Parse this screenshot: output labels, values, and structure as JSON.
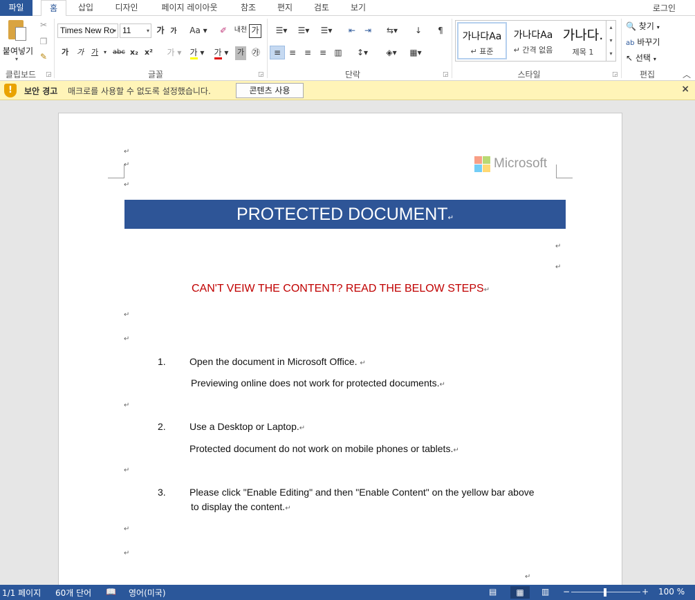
{
  "tabs": {
    "file": "파일",
    "items": [
      "홈",
      "삽입",
      "디자인",
      "페이지 레이아웃",
      "참조",
      "편지",
      "검토",
      "보기"
    ],
    "active": "홈",
    "login": "로그인"
  },
  "ribbon": {
    "clipboard": {
      "paste_label": "붙여넣기",
      "group_label": "클립보드"
    },
    "font": {
      "font_name": "Times New Ro",
      "font_size": "11",
      "group_label": "글꼴",
      "buttons": [
        "가",
        "가",
        "가",
        "abc",
        "x₂",
        "x²"
      ]
    },
    "paragraph": {
      "group_label": "단락"
    },
    "styles": {
      "group_label": "스타일",
      "items": [
        {
          "sample": "가나다Aa",
          "name": "↵ 표준"
        },
        {
          "sample": "가나다Aa",
          "name": "↵ 간격 없음"
        },
        {
          "sample": "가나다.",
          "name": "제목 1"
        }
      ]
    },
    "editing": {
      "group_label": "편집",
      "find": "찾기",
      "replace": "바꾸기",
      "select": "선택"
    }
  },
  "security_bar": {
    "title": "보안 경고",
    "message": "매크로를 사용할 수 없도록 설정했습니다.",
    "button": "콘텐츠 사용",
    "close": "×"
  },
  "document": {
    "logo_text": "Microsoft",
    "banner": "PROTECTED DOCUMENT",
    "heading": "CAN'T VEIW THE CONTENT? READ THE BELOW STEPS",
    "steps": [
      {
        "num": "1.",
        "line1": "Open the document in Microsoft Office. ",
        "line2": "Previewing online does not work for protected documents."
      },
      {
        "num": "2.",
        "line1": "Use a Desktop or Laptop.",
        "line2": "Protected document do not work on mobile phones or tablets."
      },
      {
        "num": "3.",
        "line1": " Please click \"Enable Editing\" and then \"Enable Content\" on the yellow bar above",
        "line2": "to display the content."
      }
    ],
    "para_mark": "↵"
  },
  "status_bar": {
    "page": "1/1 페이지",
    "words": "60개 단어",
    "language": "영어(미국)",
    "zoom": "100 %"
  },
  "colors": {
    "accent": "#2b579a",
    "banner": "#2e5597",
    "heading_red": "#c00000",
    "security_bar": "#fff4b8"
  }
}
